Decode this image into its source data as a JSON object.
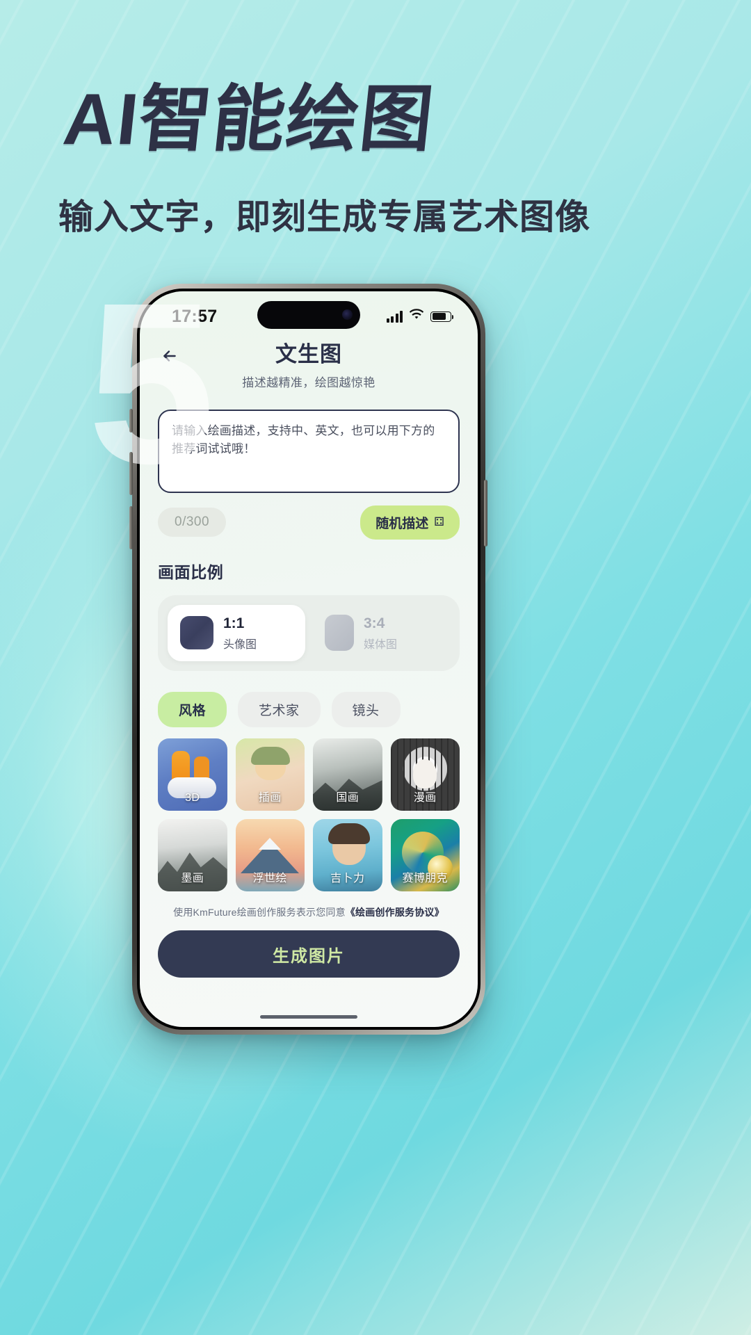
{
  "promo": {
    "headline": "AI智能绘图",
    "subhead": "输入文字，即刻生成专属艺术图像",
    "watermark": "5",
    "bg_color_start": "#b6ece8",
    "bg_color_end": "#6fd9e0",
    "headline_color": "#2e3146"
  },
  "status_bar": {
    "time": "17:57",
    "signal_icon": "signal-bars-icon",
    "wifi_icon": "wifi-icon",
    "battery_icon": "battery-icon"
  },
  "header": {
    "back_icon": "back-arrow-icon",
    "title": "文生图",
    "subtitle": "描述越精准，绘图越惊艳"
  },
  "prompt": {
    "placeholder": "请输入绘画描述，支持中、英文，也可以用下方的推荐词试试哦！",
    "value": "",
    "counter": "0/300",
    "random_label": "随机描述",
    "random_icon": "dice-icon"
  },
  "ratio": {
    "section_title": "画面比例",
    "options": [
      {
        "ratio": "1:1",
        "name": "头像图",
        "selected": true
      },
      {
        "ratio": "3:4",
        "name": "媒体图",
        "selected": false
      }
    ]
  },
  "tabs": [
    {
      "label": "风格",
      "active": true
    },
    {
      "label": "艺术家",
      "active": false
    },
    {
      "label": "镜头",
      "active": false
    }
  ],
  "styles": [
    {
      "label": "3D",
      "selected": false,
      "art": "art-3d"
    },
    {
      "label": "插画",
      "selected": true,
      "art": "art-illu"
    },
    {
      "label": "国画",
      "selected": false,
      "art": "art-guohua"
    },
    {
      "label": "漫画",
      "selected": false,
      "art": "art-manga"
    },
    {
      "label": "墨画",
      "selected": false,
      "art": "art-ink"
    },
    {
      "label": "浮世绘",
      "selected": false,
      "art": "art-ukiyo"
    },
    {
      "label": "吉卜力",
      "selected": false,
      "art": "art-ghibli"
    },
    {
      "label": "赛博朋克",
      "selected": false,
      "art": "art-cyber"
    }
  ],
  "footer": {
    "agreement_prefix": "使用KmFuture绘画创作服务表示您同意",
    "agreement_link": "《绘画创作服务协议》",
    "generate_label": "生成图片",
    "generate_bg": "#333a53",
    "generate_text_color": "#cfe8a4"
  }
}
